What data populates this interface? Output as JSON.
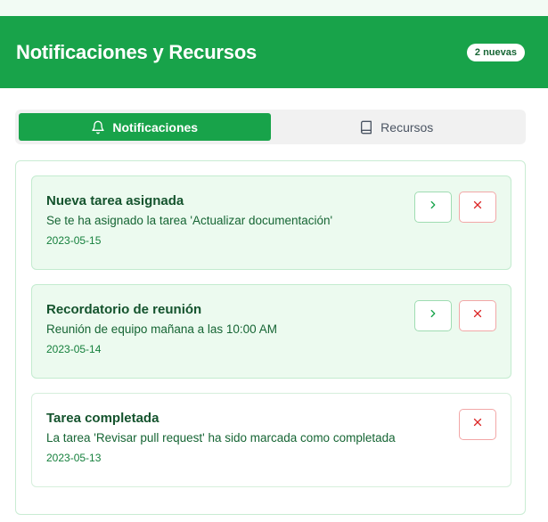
{
  "header": {
    "title": "Notificaciones y Recursos",
    "badge": "2 nuevas"
  },
  "tabs": [
    {
      "label": "Notificaciones",
      "icon": "bell-icon",
      "active": true
    },
    {
      "label": "Recursos",
      "icon": "book-icon",
      "active": false
    }
  ],
  "notifications": [
    {
      "title": "Nueva tarea asignada",
      "message": "Se te ha asignado la tarea 'Actualizar documentación'",
      "date": "2023-05-15",
      "unread": true
    },
    {
      "title": "Recordatorio de reunión",
      "message": "Reunión de equipo mañana a las 10:00 AM",
      "date": "2023-05-14",
      "unread": true
    },
    {
      "title": "Tarea completada",
      "message": "La tarea 'Revisar pull request' ha sido marcada como completada",
      "date": "2023-05-13",
      "unread": false
    }
  ],
  "colors": {
    "brand": "#18a34a",
    "unread_bg": "#ecfaef",
    "dismiss": "#dc2626"
  }
}
